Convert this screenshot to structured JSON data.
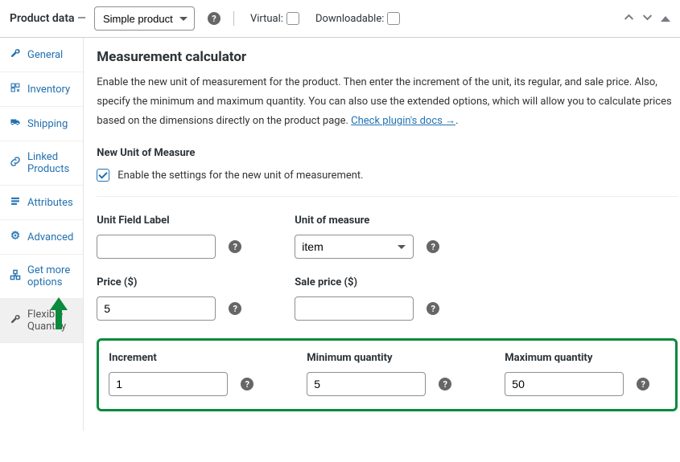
{
  "header": {
    "title_prefix": "Product data",
    "dash": " — ",
    "product_type": "Simple product",
    "virtual_label": "Virtual:",
    "downloadable_label": "Downloadable:"
  },
  "sidebar": {
    "items": [
      {
        "label": "General"
      },
      {
        "label": "Inventory"
      },
      {
        "label": "Shipping"
      },
      {
        "label": "Linked Products"
      },
      {
        "label": "Attributes"
      },
      {
        "label": "Advanced"
      },
      {
        "label": "Get more options"
      },
      {
        "label": "Flexible Quantity"
      }
    ]
  },
  "content": {
    "title": "Measurement calculator",
    "description_pre": "Enable the new unit of measurement for the product. Then enter the increment of the unit, its regular, and sale price. Also, specify the minimum and maximum quantity. You can also use the extended options, which will allow you to calculate prices based on the dimensions directly on the product page. ",
    "docs_link": "Check plugin's docs →",
    "docs_suffix": ".",
    "new_unit_heading": "New Unit of Measure",
    "enable_text": "Enable the settings for the new unit of measurement.",
    "fields": {
      "unit_field_label": "Unit Field Label",
      "unit_of_measure": "Unit of measure",
      "unit_of_measure_value": "item",
      "price_label": "Price ($)",
      "price_value": "5",
      "sale_price_label": "Sale price ($)",
      "sale_price_value": "",
      "increment_label": "Increment",
      "increment_value": "1",
      "min_qty_label": "Minimum quantity",
      "min_qty_value": "5",
      "max_qty_label": "Maximum quantity",
      "max_qty_value": "50"
    }
  }
}
